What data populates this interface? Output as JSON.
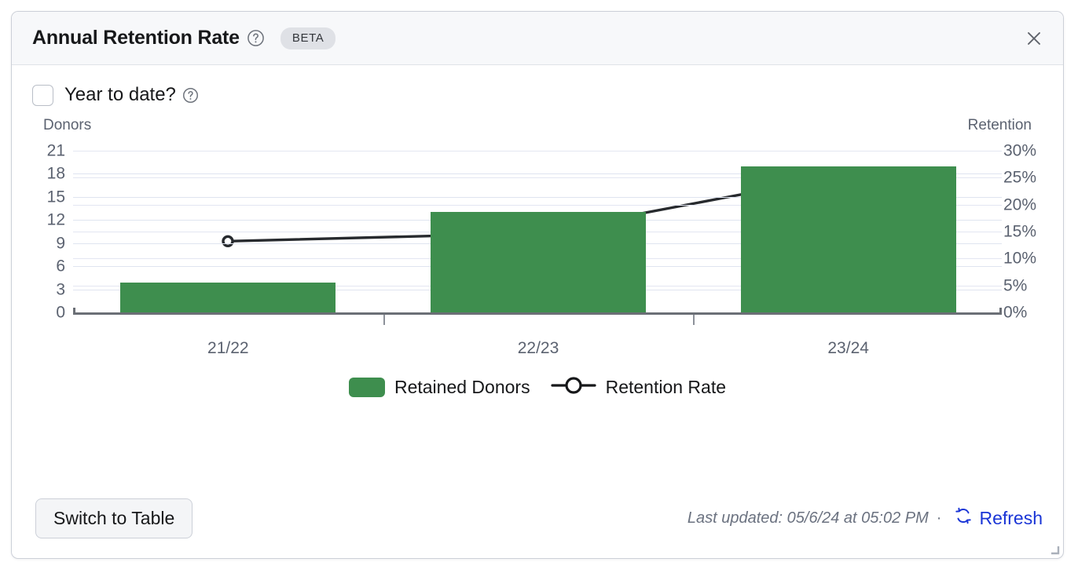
{
  "header": {
    "title": "Annual Retention Rate",
    "help_icon": "question-circle-icon",
    "badge": "BETA",
    "close_icon": "close-icon"
  },
  "controls": {
    "ytd_label": "Year to date?",
    "ytd_checked": false,
    "ytd_help_icon": "question-circle-icon"
  },
  "footer": {
    "switch_label": "Switch to Table",
    "last_updated": "Last updated: 05/6/24 at 05:02 PM",
    "separator": "·",
    "refresh_label": "Refresh",
    "refresh_icon": "refresh-icon",
    "refresh_color": "#1a35d6"
  },
  "chart_data": {
    "type": "bar",
    "title": "Annual Retention Rate",
    "categories": [
      "21/22",
      "22/23",
      "23/24"
    ],
    "xlabel": "",
    "ylabel": "Donors",
    "y2label": "Retention",
    "ylim": [
      0,
      21
    ],
    "y2lim": [
      0,
      30
    ],
    "yticks": [
      "0",
      "3",
      "6",
      "9",
      "12",
      "15",
      "18",
      "21"
    ],
    "ytick_values": [
      0,
      3,
      6,
      9,
      12,
      15,
      18,
      21
    ],
    "y2ticks": [
      "0%",
      "5%",
      "10%",
      "15%",
      "20%",
      "25%",
      "30%"
    ],
    "y2tick_values": [
      0,
      5,
      10,
      15,
      20,
      25,
      30
    ],
    "grid": true,
    "legend_position": "bottom",
    "bar_color": "#3e8e4e",
    "line_color": "#272a2e",
    "series": [
      {
        "name": "Retained Donors",
        "type": "bar",
        "axis": "left",
        "values": [
          3.9,
          13,
          19
        ],
        "color": "#3e8e4e"
      },
      {
        "name": "Retention Rate",
        "type": "line",
        "axis": "right",
        "values": [
          13.2,
          14.7,
          25.6
        ],
        "color": "#272a2e"
      }
    ]
  }
}
